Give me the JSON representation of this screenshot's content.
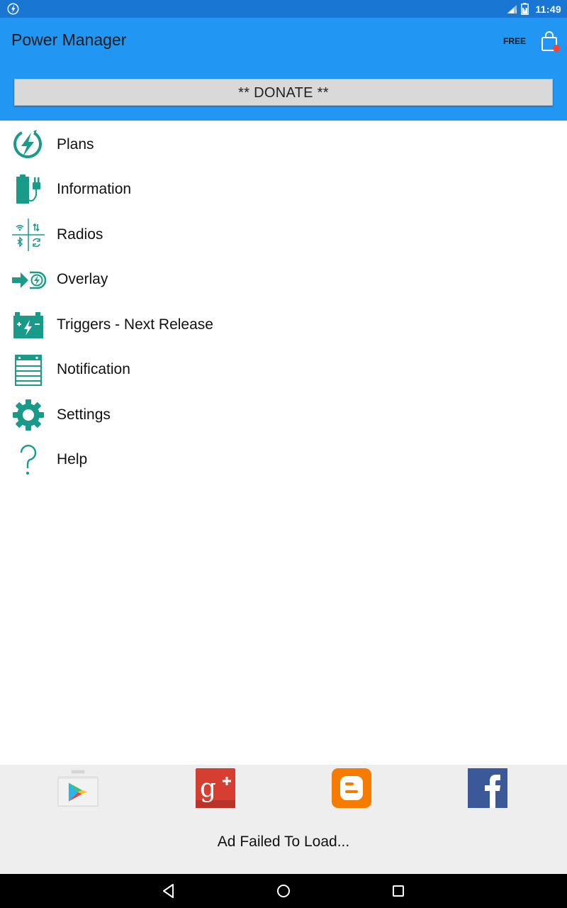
{
  "status_bar": {
    "time": "11:49",
    "icons": [
      "app-bolt-icon",
      "signal-icon",
      "battery-charging-icon"
    ]
  },
  "app_bar": {
    "title": "Power Manager",
    "badge": "FREE",
    "donate_label": "** DONATE **",
    "color": "#2196f3"
  },
  "menu": {
    "accent_color": "#1a9a88",
    "items": [
      {
        "label": "Plans",
        "icon": "lightning-circle-icon"
      },
      {
        "label": "Information",
        "icon": "battery-plug-icon"
      },
      {
        "label": "Radios",
        "icon": "radios-grid-icon"
      },
      {
        "label": "Overlay",
        "icon": "overlay-arrow-icon"
      },
      {
        "label": "Triggers - Next Release",
        "icon": "battery-trigger-icon"
      },
      {
        "label": "Notification",
        "icon": "notification-list-icon"
      },
      {
        "label": "Settings",
        "icon": "gear-icon"
      },
      {
        "label": "Help",
        "icon": "question-icon"
      }
    ]
  },
  "social_bar": {
    "links": [
      {
        "name": "Google Play",
        "icon": "play-store-icon"
      },
      {
        "name": "Google+",
        "icon": "google-plus-icon"
      },
      {
        "name": "Blogger",
        "icon": "blogger-icon"
      },
      {
        "name": "Facebook",
        "icon": "facebook-icon"
      }
    ],
    "ad_message": "Ad Failed To Load..."
  },
  "nav_bar": {
    "buttons": [
      "back-icon",
      "home-icon",
      "recents-icon"
    ]
  }
}
